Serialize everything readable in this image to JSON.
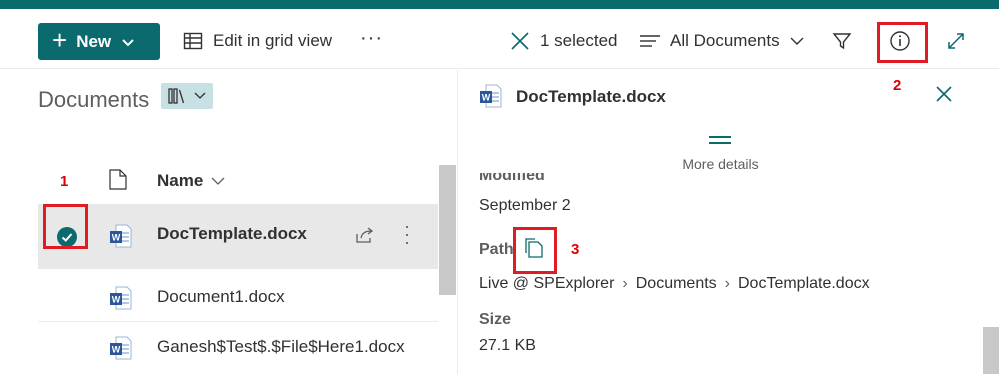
{
  "toolbar": {
    "new_label": "New",
    "edit_grid_label": "Edit in grid view",
    "more_label": "···",
    "selected_label": "1 selected",
    "view_label": "All Documents"
  },
  "library": {
    "title": "Documents",
    "column_name": "Name",
    "files": [
      {
        "name": "DocTemplate.docx",
        "selected": true
      },
      {
        "name": "Document1.docx",
        "selected": false
      },
      {
        "name": "Ganesh$Test$.$File$Here1.docx",
        "selected": false
      }
    ]
  },
  "details": {
    "file_name": "DocTemplate.docx",
    "more_details_label": "More details",
    "modified_label_partial": "Modified",
    "modified_value": "September 2",
    "path_label": "Path",
    "breadcrumb": [
      "Live @ SPExplorer",
      "Documents",
      "DocTemplate.docx"
    ],
    "size_label": "Size",
    "size_value": "27.1 KB"
  },
  "annotations": [
    "1",
    "2",
    "3"
  ],
  "colors": {
    "brand": "#0b6a6e",
    "highlight": "#e01b24"
  }
}
